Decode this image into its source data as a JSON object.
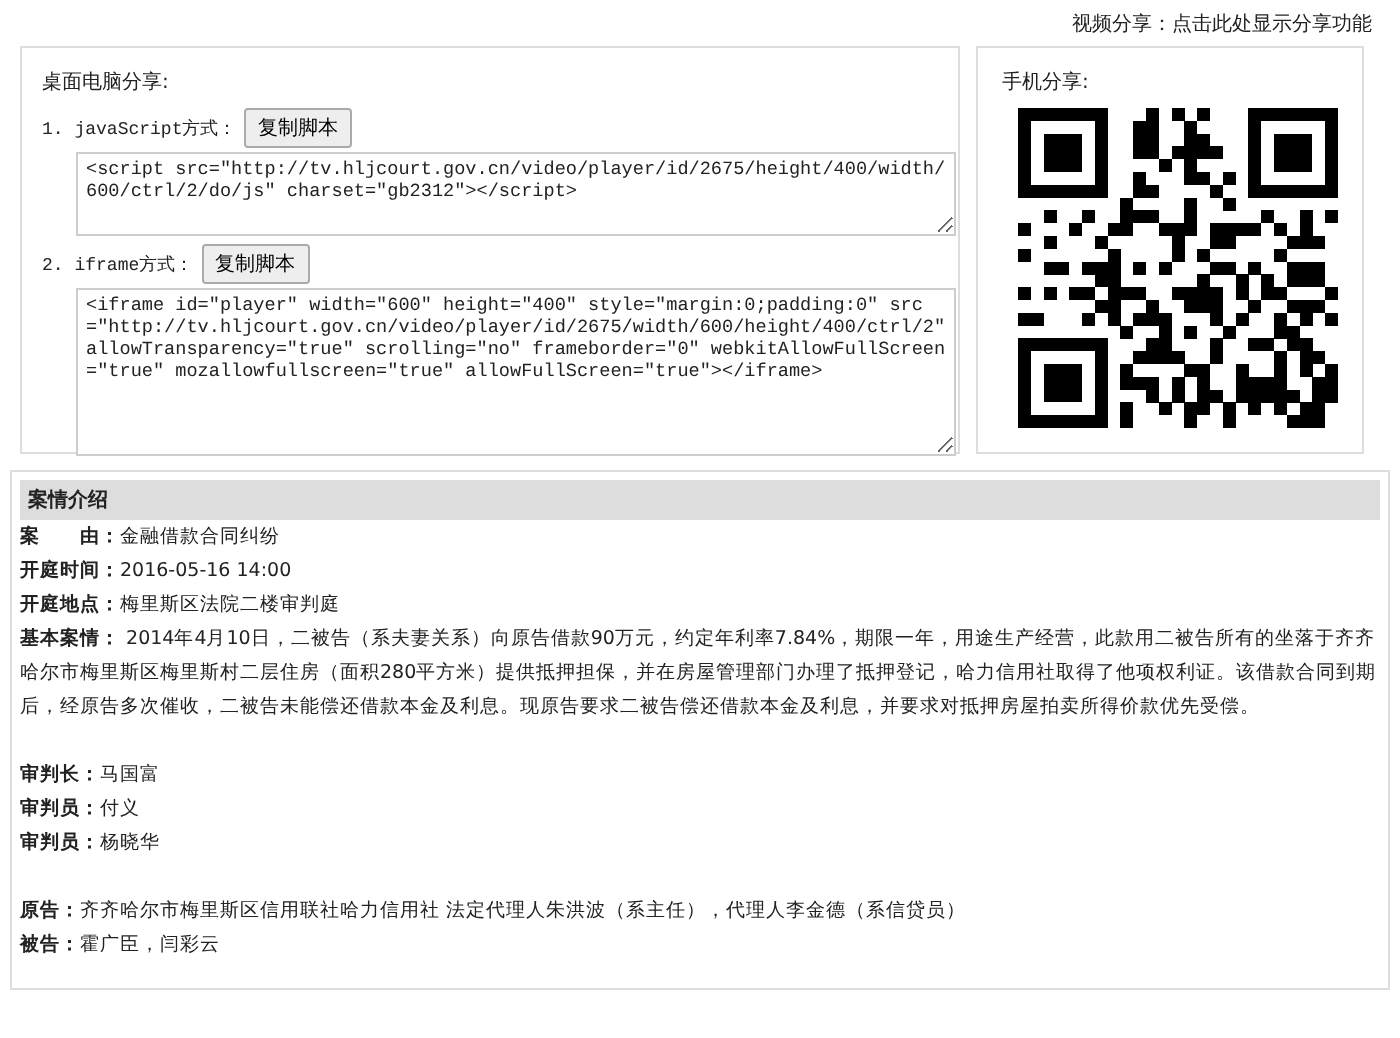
{
  "top_link": "视频分享：点击此处显示分享功能",
  "desktop_share": {
    "title": "桌面电脑分享:",
    "methods": [
      {
        "number": "1.",
        "label": "javaScript方式：",
        "button": "复制脚本",
        "code": "<script src=\"http://tv.hljcourt.gov.cn/video/player/id/2675/height/400/width/600/ctrl/2/do/js\" charset=\"gb2312\"></script>"
      },
      {
        "number": "2.",
        "label": "iframe方式：",
        "button": "复制脚本",
        "code": "<iframe id=\"player\" width=\"600\" height=\"400\" style=\"margin:0;padding:0\" src=\"http://tv.hljcourt.gov.cn/video/player/id/2675/width/600/height/400/ctrl/2\" allowTransparency=\"true\" scrolling=\"no\" frameborder=\"0\" webkitAllowFullScreen=\"true\" mozallowfullscreen=\"true\" allowFullScreen=\"true\"></iframe>"
      }
    ]
  },
  "mobile_share": {
    "title": "手机分享:"
  },
  "case": {
    "title": "案情介绍",
    "groups": [
      [
        {
          "label": "案　　由：",
          "value": "金融借款合同纠纷"
        },
        {
          "label": "开庭时间：",
          "value": "2016-05-16 14:00"
        },
        {
          "label": "开庭地点：",
          "value": "梅里斯区法院二楼审判庭"
        },
        {
          "label": "基本案情：",
          "value": " 2014年4月10日，二被告（系夫妻关系）向原告借款90万元，约定年利率7.84%，期限一年，用途生产经营，此款用二被告所有的坐落于齐齐哈尔市梅里斯区梅里斯村二层住房（面积280平方米）提供抵押担保，并在房屋管理部门办理了抵押登记，哈力信用社取得了他项权利证。该借款合同到期后，经原告多次催收，二被告未能偿还借款本金及利息。现原告要求二被告偿还借款本金及利息，并要求对抵押房屋拍卖所得价款优先受偿。"
        }
      ],
      [
        {
          "label": "审判长：",
          "value": "马国富"
        },
        {
          "label": "审判员：",
          "value": "付义"
        },
        {
          "label": "审判员：",
          "value": "杨晓华"
        }
      ],
      [
        {
          "label": "原告：",
          "value": "齐齐哈尔市梅里斯区信用联社哈力信用社 法定代理人朱洪波（系主任），代理人李金德（系信贷员）"
        },
        {
          "label": "被告：",
          "value": "霍广臣，闫彩云"
        }
      ]
    ]
  }
}
